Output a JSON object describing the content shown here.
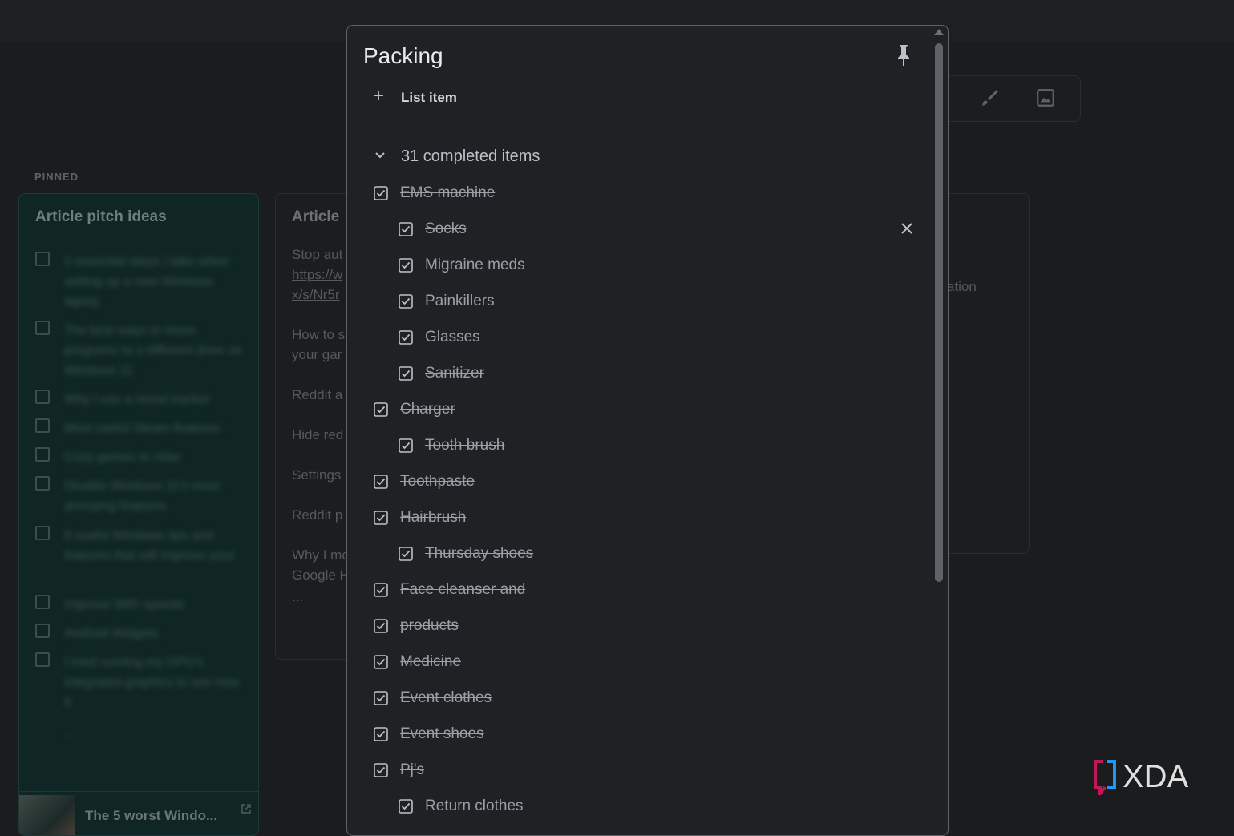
{
  "background": {
    "section_label": "PINNED",
    "pitch_card": {
      "title": "Article pitch ideas",
      "items": [
        "5 essential steps I take when setting up a new Windows laptop",
        "The best ways to move programs to a different drive on Windows 11",
        "Why I use a mood tracker",
        "Most useful Steam features",
        "Cozy games to relax",
        "Disable Windows 11's most annoying features",
        "9 useful Windows tips and features that will improve your",
        "Improve WiFi speeds",
        "Android Widgets",
        "I tried running my GPU's integrated graphics to see how it"
      ],
      "ellipsis": "...",
      "footer_title": "The 5 worst Windo...",
      "footer_icon": "open-external-icon"
    },
    "article_card": {
      "title": "Article",
      "lines": [
        "Stop aut",
        "https://w",
        "x/s/Nr5r",
        "How to s",
        "your gar",
        "Reddit a",
        "Hide red",
        "Settings",
        "Reddit p",
        "Why I mo",
        "Google H",
        "..."
      ]
    },
    "right_card_fragment": "ation",
    "toolbar_icons": [
      "brush-icon",
      "image-icon"
    ]
  },
  "note": {
    "title": "Packing",
    "add_item_label": "List item",
    "completed_label": "31 completed items",
    "items": [
      {
        "text": "EMS machine ",
        "indent": 0
      },
      {
        "text": "Socks ",
        "indent": 1
      },
      {
        "text": "Migraine meds",
        "indent": 1
      },
      {
        "text": "Painkillers",
        "indent": 1
      },
      {
        "text": "Glasses",
        "indent": 1
      },
      {
        "text": "Sanitizer",
        "indent": 1
      },
      {
        "text": "Charger ",
        "indent": 0
      },
      {
        "text": "Tooth brush",
        "indent": 1
      },
      {
        "text": "Toothpaste ",
        "indent": 0
      },
      {
        "text": "Hairbrush",
        "indent": 0
      },
      {
        "text": "Thursday shoes",
        "indent": 1
      },
      {
        "text": "Face cleanser and ",
        "indent": 0
      },
      {
        "text": "products",
        "indent": 0
      },
      {
        "text": "Medicine",
        "indent": 0
      },
      {
        "text": "Event clothes",
        "indent": 0
      },
      {
        "text": "Event shoes",
        "indent": 0
      },
      {
        "text": "Pj's",
        "indent": 0
      },
      {
        "text": "Return clothes ",
        "indent": 1
      }
    ],
    "icons": {
      "pin": "pin-icon",
      "add": "plus-icon",
      "collapse": "chevron-down-icon",
      "remove": "close-icon"
    }
  },
  "watermark": {
    "text": "XDA"
  },
  "colors": {
    "modal_bg": "#202124",
    "card_teal": "#0f2624",
    "text_muted": "#9aa0a6"
  }
}
